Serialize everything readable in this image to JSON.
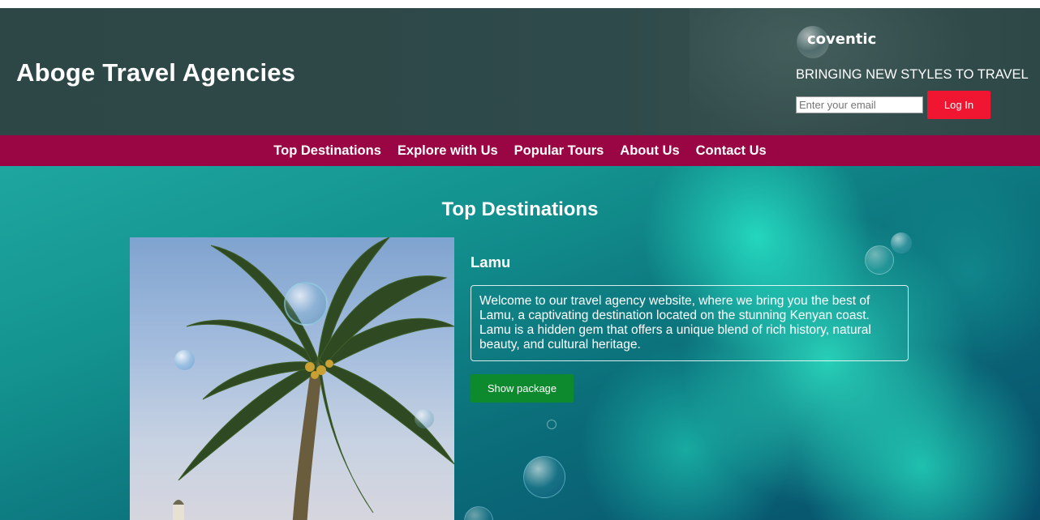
{
  "header": {
    "site_title": "Aboge Travel Agencies",
    "logo_text": "coventic",
    "tagline": "BRINGING NEW STYLES TO TRAVEL",
    "email_placeholder": "Enter your email",
    "login_label": "Log In"
  },
  "nav": {
    "items": [
      {
        "label": "Top Destinations"
      },
      {
        "label": "Explore with Us"
      },
      {
        "label": "Popular Tours"
      },
      {
        "label": "About Us"
      },
      {
        "label": "Contact Us"
      }
    ]
  },
  "main": {
    "section_title": "Top Destinations",
    "destination": {
      "name": "Lamu",
      "description": "Welcome to our travel agency website, where we bring you the best of Lamu, a captivating destination located on the stunning Kenyan coast. Lamu is a hidden gem that offers a unique blend of rich history, natural beauty, and cultural heritage.",
      "button_label": "Show package",
      "image": "palm-tree-image"
    }
  },
  "colors": {
    "header_bg": "#2f4a4a",
    "nav_bg": "#9a0543",
    "login_button": "#f01530",
    "show_button": "#0c8a2d",
    "main_bg": "#13928f"
  }
}
